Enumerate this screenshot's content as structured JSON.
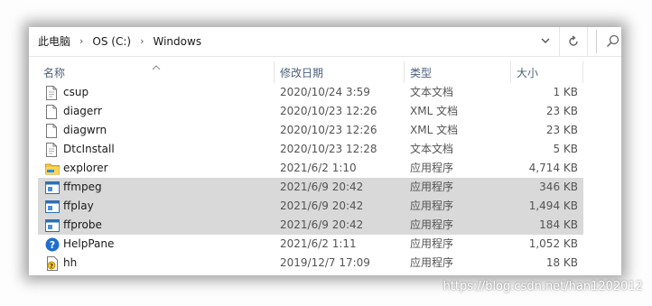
{
  "address": {
    "crumbs": [
      "此电脑",
      "OS (C:)",
      "Windows"
    ],
    "separator": "›"
  },
  "columns": {
    "name": "名称",
    "date": "修改日期",
    "type": "类型",
    "size": "大小"
  },
  "files": [
    {
      "name": "csup",
      "date": "2020/10/24 3:59",
      "type": "文本文档",
      "size": "1 KB",
      "icon": "text-file-icon",
      "selected": false
    },
    {
      "name": "diagerr",
      "date": "2020/10/23 12:26",
      "type": "XML 文档",
      "size": "23 KB",
      "icon": "xml-file-icon",
      "selected": false
    },
    {
      "name": "diagwrn",
      "date": "2020/10/23 12:26",
      "type": "XML 文档",
      "size": "23 KB",
      "icon": "xml-file-icon",
      "selected": false
    },
    {
      "name": "DtcInstall",
      "date": "2020/10/23 12:28",
      "type": "文本文档",
      "size": "5 KB",
      "icon": "text-file-icon",
      "selected": false
    },
    {
      "name": "explorer",
      "date": "2021/6/2 1:10",
      "type": "应用程序",
      "size": "4,714 KB",
      "icon": "explorer-icon",
      "selected": false
    },
    {
      "name": "ffmpeg",
      "date": "2021/6/9 20:42",
      "type": "应用程序",
      "size": "346 KB",
      "icon": "app-icon",
      "selected": true
    },
    {
      "name": "ffplay",
      "date": "2021/6/9 20:42",
      "type": "应用程序",
      "size": "1,494 KB",
      "icon": "app-icon",
      "selected": true
    },
    {
      "name": "ffprobe",
      "date": "2021/6/9 20:42",
      "type": "应用程序",
      "size": "184 KB",
      "icon": "app-icon",
      "selected": true
    },
    {
      "name": "HelpPane",
      "date": "2021/6/2 1:11",
      "type": "应用程序",
      "size": "1,052 KB",
      "icon": "help-icon",
      "selected": false
    },
    {
      "name": "hh",
      "date": "2019/12/7 17:09",
      "type": "应用程序",
      "size": "18 KB",
      "icon": "help-doc-icon",
      "selected": false
    }
  ],
  "watermark": "https://blog.csdn.net/han1202012"
}
